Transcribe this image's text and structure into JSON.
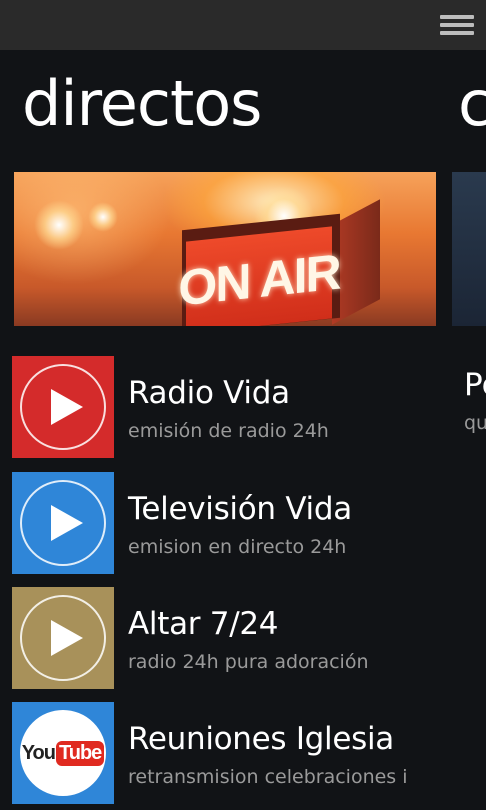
{
  "app": {
    "pivot_title": "directos",
    "next_pivot_peek": "c"
  },
  "hero": {
    "sign_text": "ON AIR"
  },
  "colors": {
    "radio": "#d42b2b",
    "television": "#2f86d8",
    "altar": "#a8915a",
    "reuniones": "#2f86d8"
  },
  "items": [
    {
      "title": "Radio Vida",
      "subtitle": "emisión de radio 24h",
      "icon": "play-icon"
    },
    {
      "title": "Televisión Vida",
      "subtitle": "emision en directo 24h",
      "icon": "play-icon"
    },
    {
      "title": "Altar 7/24",
      "subtitle": "radio 24h pura adoración",
      "icon": "play-icon"
    },
    {
      "title": "Reuniones Iglesia",
      "subtitle": "retransmision celebraciones i",
      "icon": "youtube-logo",
      "logo_text_you": "You",
      "logo_text_tube": "Tube"
    }
  ],
  "side_peek": {
    "title": "Pe",
    "subtitle": "qu"
  }
}
